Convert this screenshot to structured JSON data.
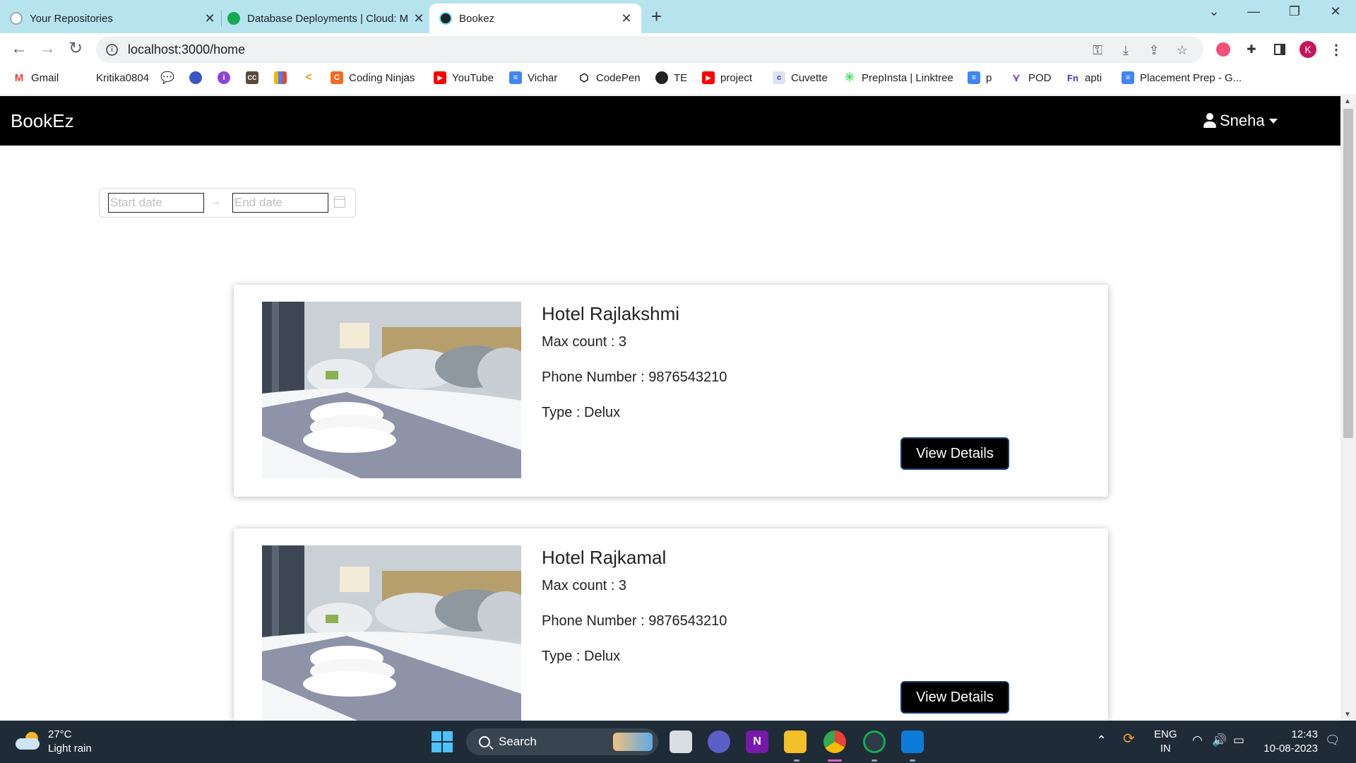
{
  "browser": {
    "tabs": [
      {
        "title": "Your Repositories",
        "icon": "github-icon",
        "active": false
      },
      {
        "title": "Database Deployments | Cloud: M",
        "icon": "mongodb-icon",
        "active": false
      },
      {
        "title": "Bookez",
        "icon": "react-icon",
        "active": true
      }
    ],
    "url": "localhost:3000/home",
    "profile_initial": "K",
    "bookmarks": [
      {
        "label": "Gmail",
        "icon": "gmail-icon"
      },
      {
        "label": "Kritika0804",
        "icon": "github-icon"
      },
      {
        "label": "",
        "icon": "chat-icon"
      },
      {
        "label": "",
        "icon": "badge-440-icon"
      },
      {
        "label": "",
        "icon": "purple-i-icon"
      },
      {
        "label": "",
        "icon": "cc-icon"
      },
      {
        "label": "",
        "icon": "bar-chart-icon"
      },
      {
        "label": "",
        "icon": "leetcode-icon"
      },
      {
        "label": "Coding Ninjas",
        "icon": "coding-ninjas-icon"
      },
      {
        "label": "YouTube",
        "icon": "youtube-icon"
      },
      {
        "label": "Vichar",
        "icon": "docs-icon"
      },
      {
        "label": "CodePen",
        "icon": "codepen-icon"
      },
      {
        "label": "TE",
        "icon": "globe-icon"
      },
      {
        "label": "project",
        "icon": "youtube-icon"
      },
      {
        "label": "Cuvette",
        "icon": "cuvette-icon"
      },
      {
        "label": "PrepInsta | Linktree",
        "icon": "linktree-icon"
      },
      {
        "label": "p",
        "icon": "docs-icon"
      },
      {
        "label": "POD",
        "icon": "pod-icon"
      },
      {
        "label": "apti",
        "icon": "fn-icon"
      },
      {
        "label": "Placement Prep - G...",
        "icon": "docs-icon"
      }
    ]
  },
  "app": {
    "brand": "BookEz",
    "user_name": "Sneha",
    "date_range": {
      "start_placeholder": "Start date",
      "end_placeholder": "End date",
      "separator": "→"
    },
    "hotels": [
      {
        "name": "Hotel Rajlakshmi",
        "max_count": "Max count : 3",
        "phone": "Phone Number : 9876543210",
        "type": "Type : Delux",
        "button": "View Details"
      },
      {
        "name": "Hotel Rajkamal",
        "max_count": "Max count : 3",
        "phone": "Phone Number : 9876543210",
        "type": "Type : Delux",
        "button": "View Details"
      }
    ]
  },
  "taskbar": {
    "weather_temp": "27°C",
    "weather_desc": "Light rain",
    "search_label": "Search",
    "lang_1": "ENG",
    "lang_2": "IN",
    "time": "12:43",
    "date": "10-08-2023"
  },
  "colors": {
    "tab_strip": "#b7e3ef",
    "navbar": "#000000",
    "taskbar": "#1f2b36",
    "button": "#000000"
  }
}
